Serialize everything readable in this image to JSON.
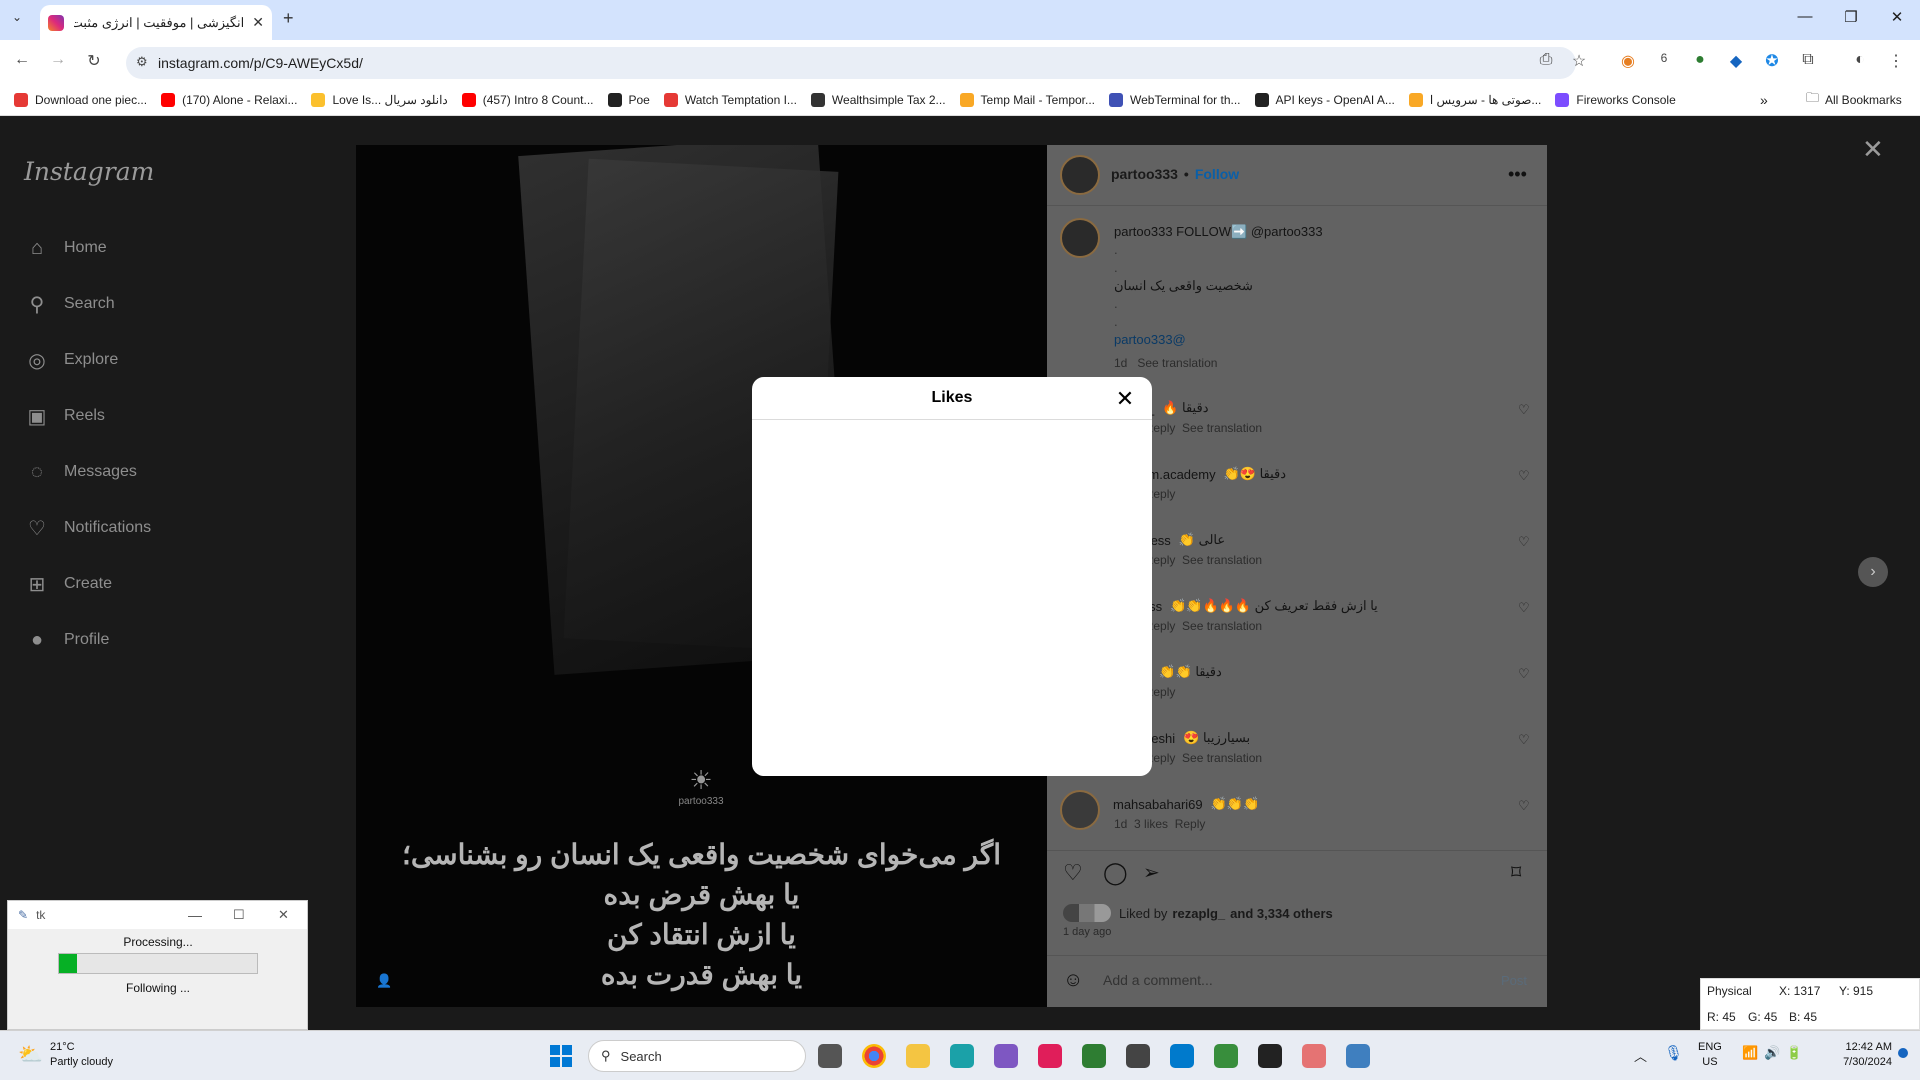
{
  "browser": {
    "tab_title": "انگیزشی | موفقیت | انرژی مثبت (:",
    "url": "instagram.com/p/C9-AWEyCx5d/",
    "bookmarks": [
      {
        "label": "Download one piec...",
        "color": "#e53935"
      },
      {
        "label": "(170) Alone - Relaxi...",
        "color": "#ff0000"
      },
      {
        "label": "Love Is... دانلود سریال",
        "color": "#fbc02d"
      },
      {
        "label": "(457) Intro 8 Count...",
        "color": "#ff0000"
      },
      {
        "label": "Poe",
        "color": "#222222"
      },
      {
        "label": "Watch Temptation I...",
        "color": "#e53935"
      },
      {
        "label": "Wealthsimple Tax 2...",
        "color": "#333333"
      },
      {
        "label": "Temp Mail - Tempor...",
        "color": "#f9a825"
      },
      {
        "label": "WebTerminal for th...",
        "color": "#3f51b5"
      },
      {
        "label": "API keys - OpenAI A...",
        "color": "#222222"
      },
      {
        "label": "صوتی ها - سرویس ا...",
        "color": "#f9a825"
      },
      {
        "label": "Fireworks Console",
        "color": "#7c4dff"
      }
    ],
    "all_bookmarks": "All Bookmarks",
    "extension_badge": "6"
  },
  "instagram": {
    "logo": "Instagram",
    "nav": [
      {
        "label": "Home",
        "icon": "home-icon",
        "glyph": "⌂"
      },
      {
        "label": "Search",
        "icon": "search-icon",
        "glyph": "⚲"
      },
      {
        "label": "Explore",
        "icon": "compass-icon",
        "glyph": "◎"
      },
      {
        "label": "Reels",
        "icon": "reels-icon",
        "glyph": "▣"
      },
      {
        "label": "Messages",
        "icon": "messenger-icon",
        "glyph": "◌"
      },
      {
        "label": "Notifications",
        "icon": "heart-icon",
        "glyph": "♡"
      },
      {
        "label": "Create",
        "icon": "plus-square-icon",
        "glyph": "⊞"
      },
      {
        "label": "Profile",
        "icon": "profile-avatar",
        "glyph": "●"
      }
    ],
    "post_text": [
      "اگر می‌خوای شخصیت واقعی یک انسان رو بشناسی؛",
      "یا بهش قرض بده",
      "یا ازش انتقاد کن",
      "یا بهش قدرت بده"
    ],
    "watermark": "partoo333",
    "author": "partoo333",
    "follow": "Follow",
    "caption": {
      "line1": "partoo333 FOLLOW➡️ @partoo333",
      "line2": "شخصیت واقعی یک انسان",
      "line3": "partoo333@",
      "time": "1d",
      "translate": "See translation"
    },
    "comments": [
      {
        "user": "_cell1_",
        "text": "🔥 دقیقا",
        "meta": "likes  Reply  See translation"
      },
      {
        "user": "myteam.academy",
        "text": "👏😍 دقیقا",
        "meta": "likes  Reply"
      },
      {
        "user": "ofsuccess",
        "text": "👏 عالی",
        "meta": "likes  Reply  See translation"
      },
      {
        "user": "mm.mss",
        "text": "👏👏🔥🔥🔥 یا ازش فقط تعریف کن",
        "meta": "likes  Reply  See translation"
      },
      {
        "user": "esh_io",
        "text": "👏👏 دقیقا",
        "meta": "likes  Reply"
      },
      {
        "user": "_angizeshi",
        "text": "😍 بسیارزیبا",
        "meta": "likes  Reply  See translation"
      },
      {
        "user": "mahsabahari69",
        "text": "👏👏👏",
        "meta": "1d  3 likes  Reply"
      }
    ],
    "liked_by": "Liked by",
    "liked_user": "rezaplg_",
    "liked_rest": "and 3,334 others",
    "posted": "1 day ago",
    "comment_placeholder": "Add a comment...",
    "post_button": "Post",
    "modal_title": "Likes"
  },
  "tk": {
    "title": "tk",
    "status": "Processing...",
    "progress": 0.09,
    "sub": "Following ..."
  },
  "picker": {
    "mode": "Physical",
    "x": "X: 1317",
    "y": "Y: 915",
    "r": "R: 45",
    "g": "G: 45",
    "b": "B: 45"
  },
  "taskbar": {
    "temp": "21°C",
    "weather": "Partly cloudy",
    "search": "Search",
    "lang1": "ENG",
    "lang2": "US",
    "time": "12:42 AM",
    "date": "7/30/2024"
  }
}
